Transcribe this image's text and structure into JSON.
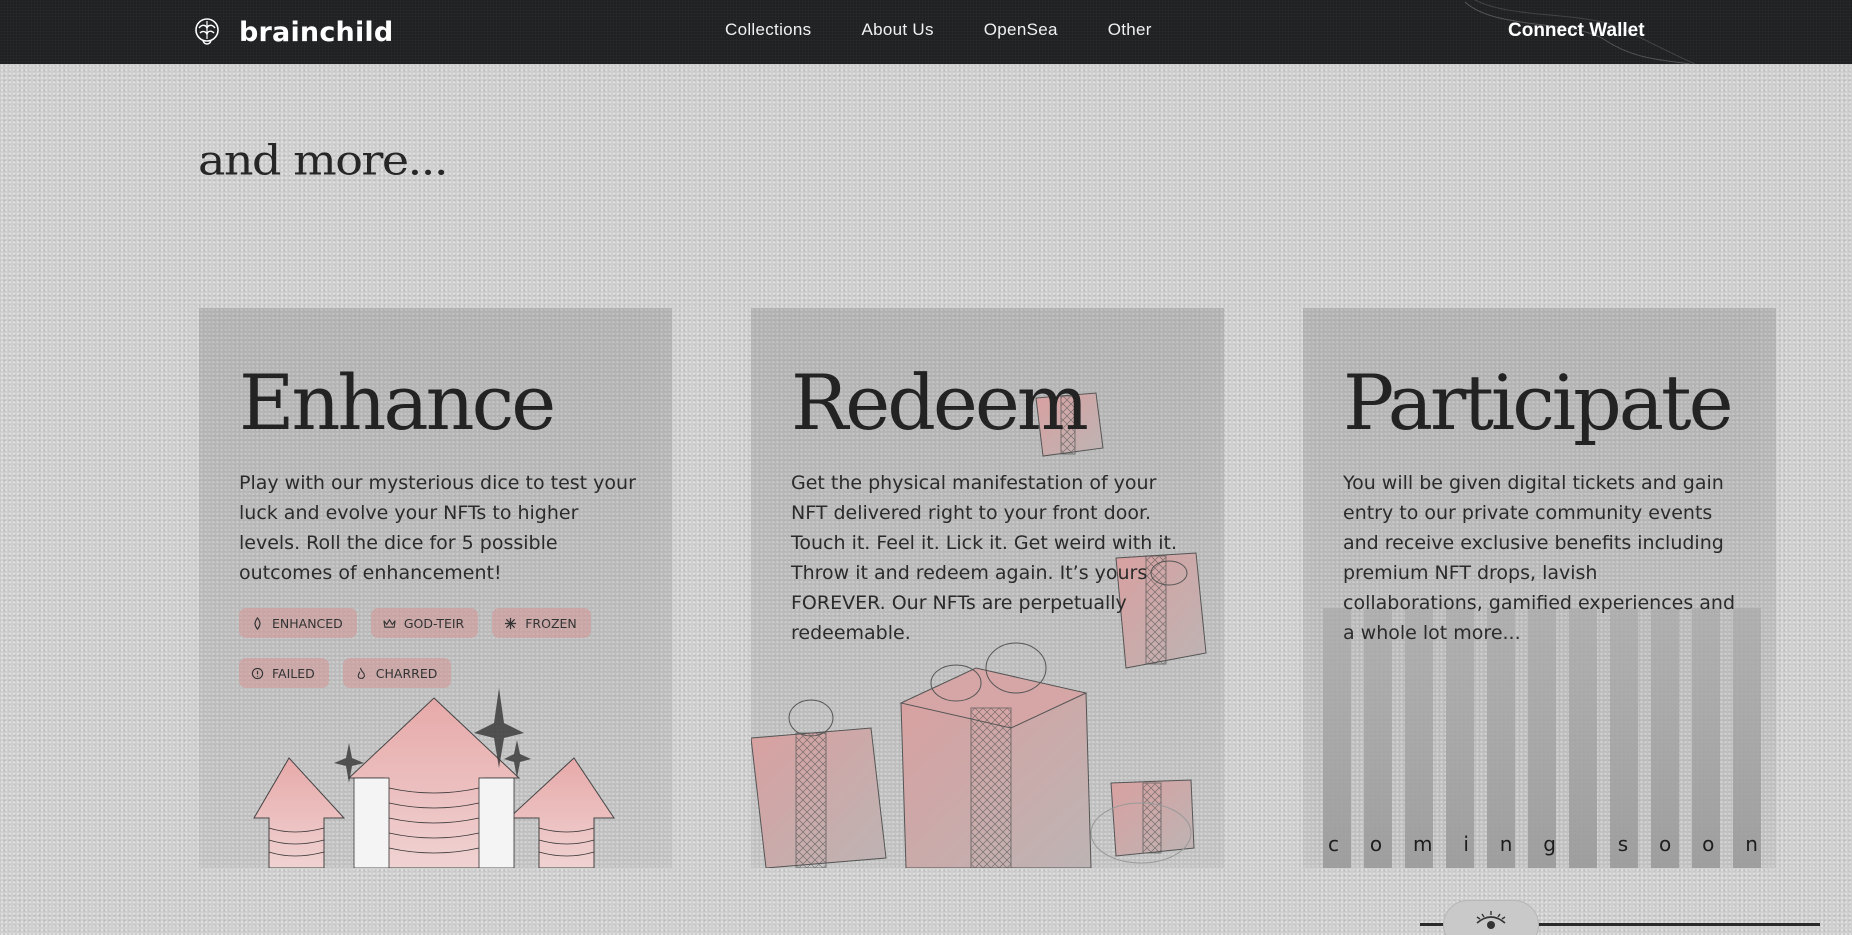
{
  "brand": {
    "name": "brainchild",
    "logo_icon": "brain-icon"
  },
  "nav": {
    "links": [
      "Collections",
      "About Us",
      "OpenSea",
      "Other"
    ],
    "cta": "Connect Wallet"
  },
  "section": {
    "title": "and more..."
  },
  "cards": [
    {
      "title": "Enhance",
      "description": "Play with our mysterious dice to test your luck and evolve your NFTs to higher levels. Roll the dice for 5 possible outcomes of enhancement!",
      "tags": [
        {
          "label": "ENHANCED",
          "icon": "flame-icon"
        },
        {
          "label": "GOD-TEIR",
          "icon": "crown-icon"
        },
        {
          "label": "FROZEN",
          "icon": "snowflake-icon"
        },
        {
          "label": "FAILED",
          "icon": "alert-circle-icon"
        },
        {
          "label": "CHARRED",
          "icon": "fire-icon"
        }
      ]
    },
    {
      "title": "Redeem",
      "description": "Get the physical manifestation of your NFT delivered right to your front door. Touch it. Feel it. Lick it. Get weird with it. Throw it and redeem again. It’s yours FOREVER. Our NFTs are perpetually redeemable."
    },
    {
      "title": "Participate",
      "description": "You will be given digital tickets and gain entry to our private community events and receive exclusive benefits including premium NFT drops, lavish collaborations, gamified experiences and a whole lot more...",
      "coming_soon": [
        "c",
        "o",
        "m",
        "i",
        "n",
        "g",
        " ",
        "s",
        "o",
        "o",
        "n"
      ]
    }
  ],
  "colors": {
    "nav_bg": "#1e1f21",
    "page_bg": "#cfcfcf",
    "tag_bg": "#d69696",
    "accent_pink": "#e0a3a3"
  },
  "scroll_indicator": {
    "icon": "eye-icon"
  }
}
